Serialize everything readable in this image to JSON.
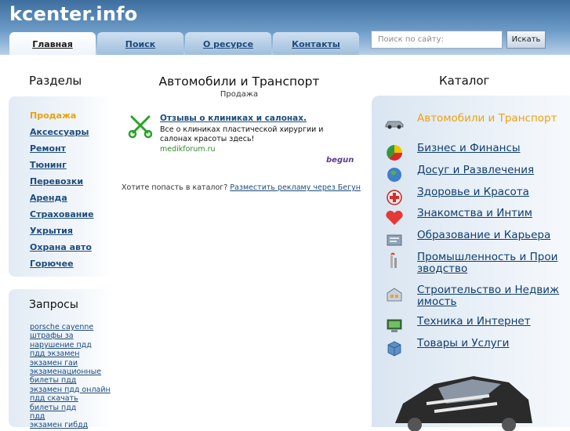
{
  "header": {
    "site_title": "kcenter.info",
    "tabs": [
      {
        "label": "Главная",
        "active": true
      },
      {
        "label": "Поиск",
        "active": false
      },
      {
        "label": "О ресурсе",
        "active": false
      },
      {
        "label": "Контакты",
        "active": false
      }
    ],
    "search": {
      "placeholder": "Поиск по сайту:",
      "button_label": "Искать"
    }
  },
  "sections": {
    "title": "Разделы",
    "items": [
      {
        "label": "Продажа",
        "active": true
      },
      {
        "label": "Аксессуары"
      },
      {
        "label": "Ремонт"
      },
      {
        "label": "Тюнинг"
      },
      {
        "label": "Перевозки"
      },
      {
        "label": "Аренда"
      },
      {
        "label": "Страхование"
      },
      {
        "label": "Укрытия"
      },
      {
        "label": "Охрана авто"
      },
      {
        "label": "Горючее"
      }
    ]
  },
  "queries": {
    "title": "Запросы",
    "items": [
      "porsche cayenne",
      "штрафы за",
      "нарушение пдд",
      "пдд экзамен",
      "экзамен гаи",
      "экзаменационные",
      "билеты пдд",
      "экзамен пдд онлайн",
      "пдд скачать",
      "билеты пдд",
      "пдд",
      "экзамен гибдд"
    ]
  },
  "main": {
    "title": "Автомобили и Транспорт",
    "subtitle": "Продажа",
    "ad": {
      "title": "Отзывы о клиниках и салонах.",
      "text": "Все о клиниках пластической хирургии и салонах красоты здесь!",
      "url": "medikforum.ru",
      "network": "begun"
    },
    "place_ad_text": "Хотите попасть в каталог?",
    "place_ad_link": "Разместить рекламу через Бегун"
  },
  "catalog": {
    "title": "Каталог",
    "items": [
      {
        "label": "Автомобили и Транспорт",
        "icon": "car-icon",
        "active": true
      },
      {
        "label": "Бизнес и Финансы",
        "icon": "pie-chart-icon"
      },
      {
        "label": "Досуг и Развлечения",
        "icon": "globe-icon"
      },
      {
        "label": "Здоровье и Красота",
        "icon": "health-icon"
      },
      {
        "label": "Знакомства и Интим",
        "icon": "heart-icon"
      },
      {
        "label": "Образование и Карьера",
        "icon": "education-icon"
      },
      {
        "label": "Промышленность и Производство",
        "icon": "industry-icon"
      },
      {
        "label": "Строительство и Недвижимость",
        "icon": "building-icon"
      },
      {
        "label": "Техника и Интернет",
        "icon": "computer-icon"
      },
      {
        "label": "Товары и Услуги",
        "icon": "goods-icon"
      }
    ]
  },
  "colors": {
    "header_gradient_top": "#3d6e9e",
    "link": "#1d4c7c",
    "active_link": "#e8a20d",
    "panel": "#e2ebf4"
  }
}
